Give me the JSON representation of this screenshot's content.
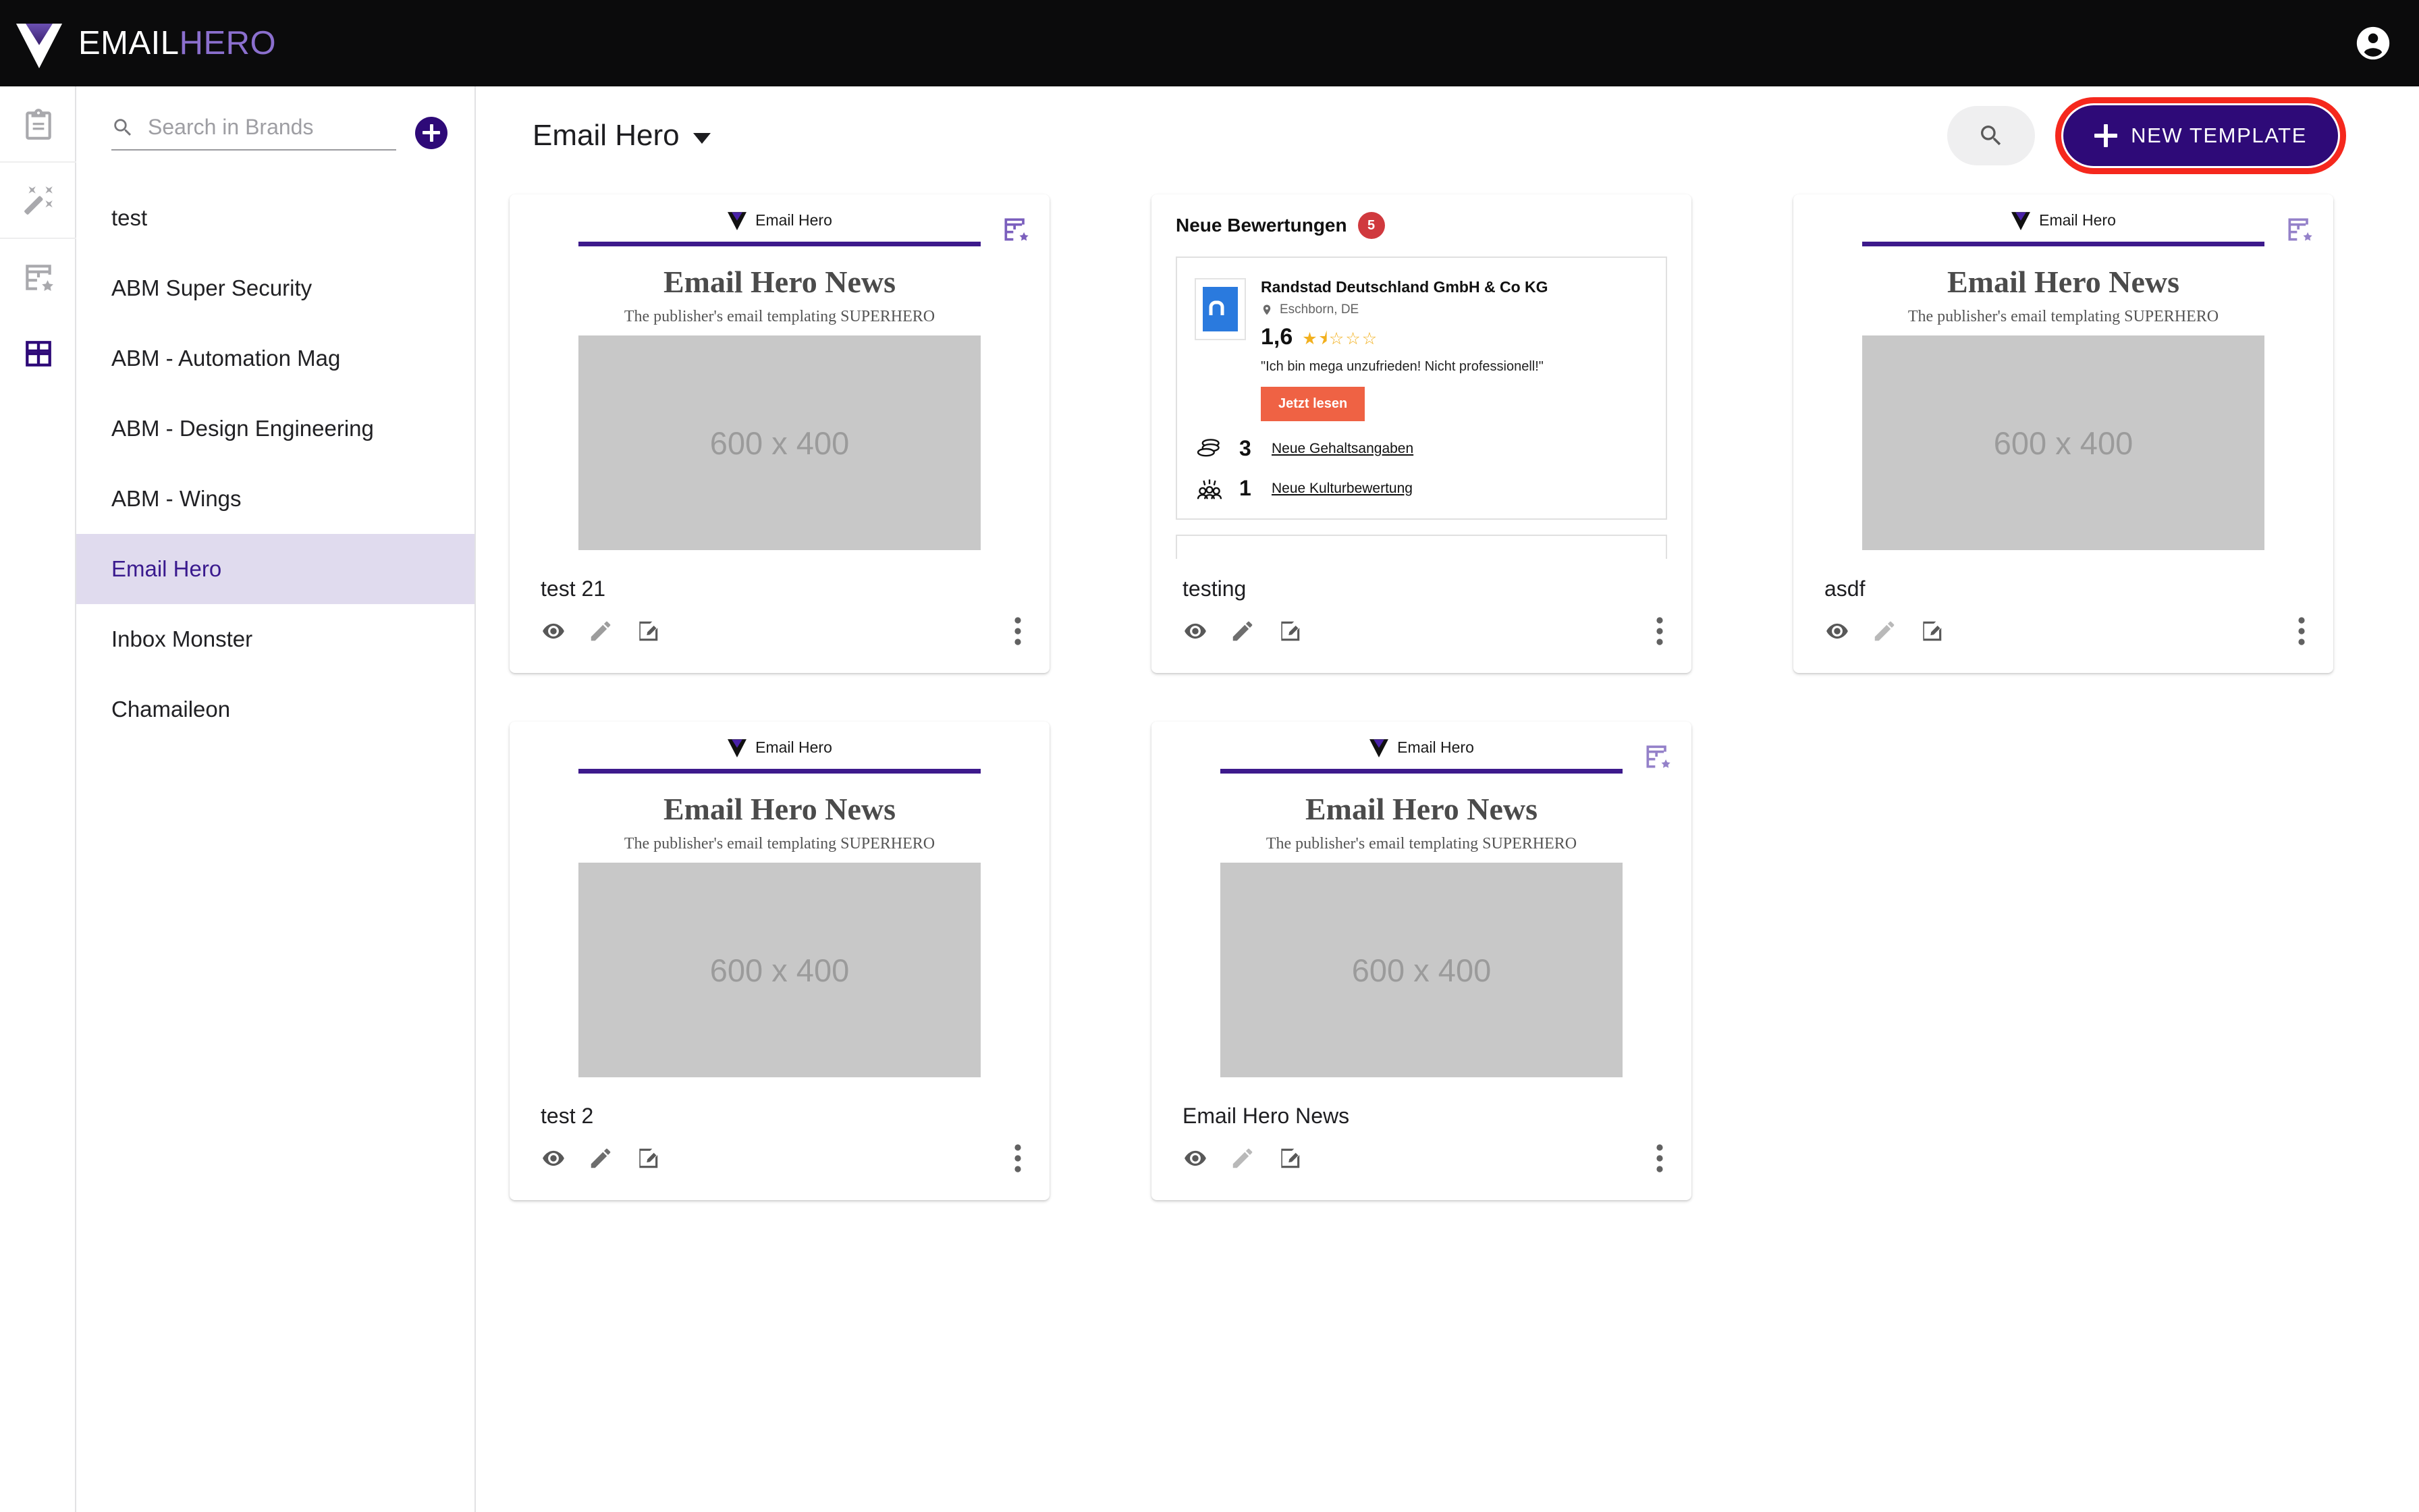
{
  "topbar": {
    "brand_email": "EMAIL",
    "brand_hero": "HERO",
    "logo_icon": "emailhero-diamond-logo",
    "avatar_icon": "account-circle-icon",
    "background_color": "#0b0b0c",
    "accent_color": "#8b6fce"
  },
  "rail": {
    "items": [
      {
        "icon": "clipboard-icon",
        "active": false
      },
      {
        "icon": "magic-wand-icon",
        "active": false
      },
      {
        "icon": "template-star-icon",
        "active": false
      },
      {
        "icon": "grid-table-icon",
        "active": true
      }
    ],
    "active_color": "#2e0a78",
    "inactive_color": "#a9a9ad"
  },
  "sidebar": {
    "search": {
      "placeholder": "Search in Brands",
      "value": "",
      "icon": "search-icon"
    },
    "add_button_icon": "plus-icon",
    "add_button_color": "#2e0a78",
    "items": [
      {
        "label": "test",
        "active": false
      },
      {
        "label": "ABM Super Security",
        "active": false
      },
      {
        "label": "ABM - Automation Mag",
        "active": false
      },
      {
        "label": "ABM - Design Engineering",
        "active": false
      },
      {
        "label": "ABM - Wings",
        "active": false
      },
      {
        "label": "Email Hero",
        "active": true
      },
      {
        "label": "Inbox Monster",
        "active": false
      },
      {
        "label": "Chamaileon",
        "active": false
      }
    ],
    "active_bg": "#e0dbee",
    "active_text": "#3a1a8e"
  },
  "main": {
    "page_title": "Email Hero",
    "title_caret_icon": "chevron-down-icon",
    "search_icon": "search-icon",
    "new_template_label": "NEW TEMPLATE",
    "new_template_plus_icon": "plus-icon",
    "new_template_bg": "#2e0a78",
    "new_template_highlight": "#f5281d"
  },
  "newsletter_preview": {
    "header_label": "Email Hero",
    "header_logo_icon": "emailhero-diamond-logo",
    "rule_color": "#3d1a8c",
    "title": "Email Hero News",
    "subtitle": "The publisher's email templating SUPERHERO",
    "image_placeholder": "600 x 400"
  },
  "review_preview": {
    "heading": "Neue Bewertungen",
    "badge_count": "5",
    "badge_color": "#d0393e",
    "company": "Randstad Deutschland GmbH & Co KG",
    "location": "Eschborn, DE",
    "location_icon": "map-pin-icon",
    "company_logo_icon": "randstad-logo",
    "score": "1,6",
    "stars": "★⯨☆☆☆",
    "stars_color": "#f2b01e",
    "quote": "\"Ich bin mega unzufrieden! Nicht professionell!\"",
    "cta_label": "Jetzt lesen",
    "cta_color": "#ef6244",
    "stats": [
      {
        "icon": "coins-icon",
        "count": "3",
        "label": "Neue Gehaltsangaben"
      },
      {
        "icon": "people-icon",
        "count": "1",
        "label": "Neue Kulturbewertung"
      }
    ]
  },
  "cards": [
    {
      "name": "test 21",
      "type": "newsletter",
      "starred": true,
      "star_color": "#7b5fbd",
      "pencil_enabled": true
    },
    {
      "name": "testing",
      "type": "review",
      "starred": false,
      "star_color": "#7b5fbd",
      "pencil_enabled": true
    },
    {
      "name": "asdf",
      "type": "newsletter",
      "starred": true,
      "star_color": "#9481c9",
      "pencil_enabled": false
    },
    {
      "name": "test 2",
      "type": "newsletter",
      "starred": false,
      "star_color": "#7b5fbd",
      "pencil_enabled": true
    },
    {
      "name": "Email Hero News",
      "type": "newsletter",
      "starred": true,
      "star_color": "#9481c9",
      "pencil_enabled": false
    }
  ],
  "card_actions": {
    "preview_icon": "eye-icon",
    "edit_icon": "pencil-icon",
    "rename_icon": "rename-note-icon",
    "more_icon": "kebab-menu-icon"
  }
}
